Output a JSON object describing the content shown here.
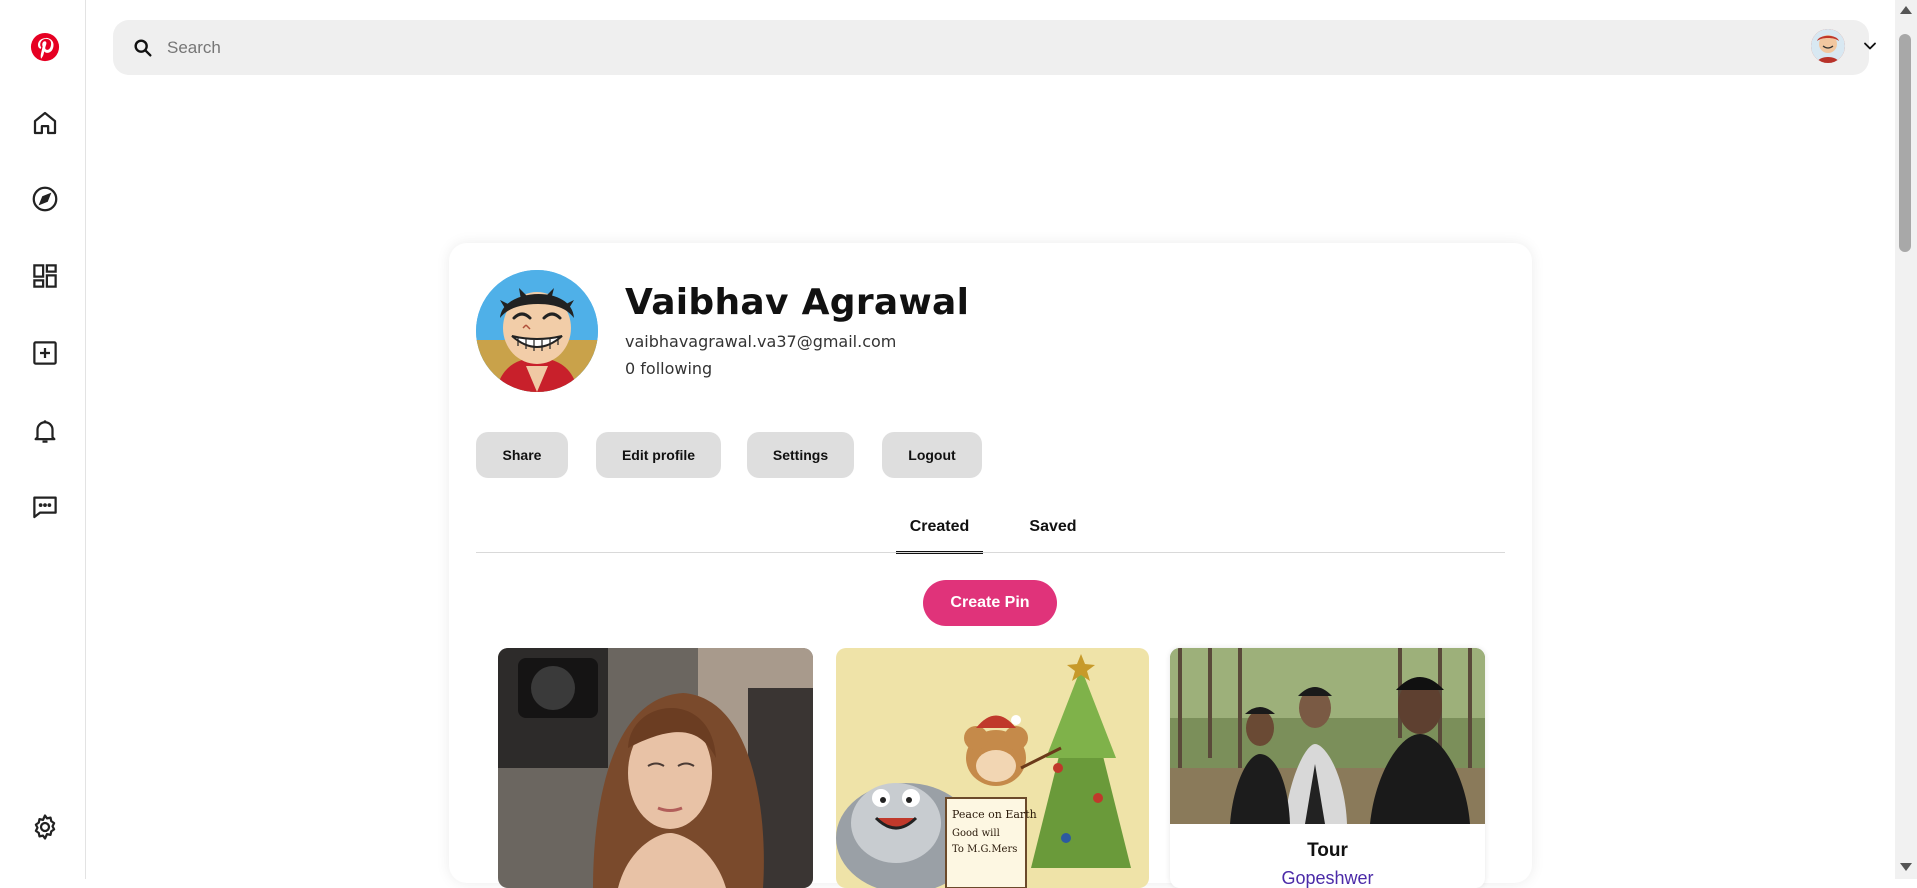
{
  "app": {
    "brand_color": "#e60023",
    "accent_color": "#e0337a"
  },
  "sidebar": {
    "items": [
      {
        "name": "pinterest-logo",
        "icon": "pinterest-icon"
      },
      {
        "name": "home",
        "icon": "home-icon"
      },
      {
        "name": "explore",
        "icon": "compass-icon"
      },
      {
        "name": "boards",
        "icon": "dashboard-icon"
      },
      {
        "name": "create",
        "icon": "add-box-icon"
      },
      {
        "name": "notifications",
        "icon": "bell-icon"
      },
      {
        "name": "messages",
        "icon": "chat-icon"
      },
      {
        "name": "settings",
        "icon": "gear-icon"
      }
    ]
  },
  "search": {
    "placeholder": "Search",
    "value": ""
  },
  "profile": {
    "name": "Vaibhav Agrawal",
    "email": "vaibhavagrawal.va37@gmail.com",
    "following": "0 following"
  },
  "actions": {
    "share": "Share",
    "edit_profile": "Edit profile",
    "settings": "Settings",
    "logout": "Logout"
  },
  "tabs": {
    "created": "Created",
    "saved": "Saved",
    "active": "created"
  },
  "create_pin_label": "Create Pin",
  "pins": [
    {
      "title": "",
      "subtitle": ""
    },
    {
      "title": "",
      "subtitle": ""
    },
    {
      "title": "Tour",
      "subtitle": "Gopeshwer"
    }
  ]
}
